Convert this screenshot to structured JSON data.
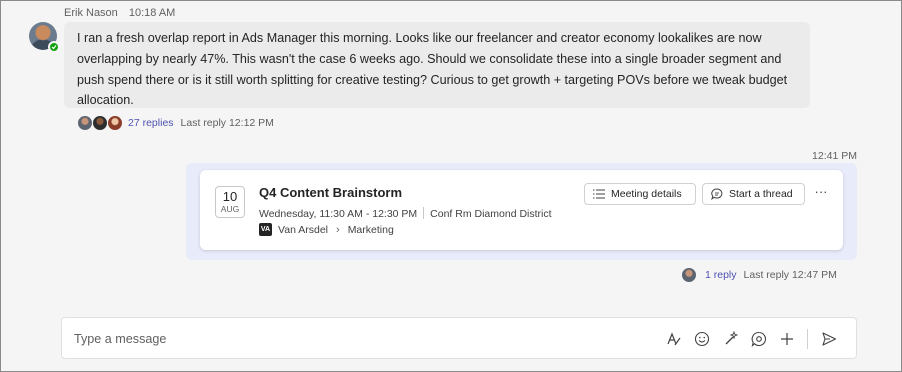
{
  "message1": {
    "sender": "Erik Nason",
    "time": "10:18 AM",
    "text": "I ran a fresh overlap report in Ads Manager this morning. Looks like our freelancer and creator economy lookalikes are now overlapping by nearly 47%. This wasn't the case 6 weeks ago. Should we consolidate these into a single broader segment and push spend there or is it still worth splitting for creative testing? Curious to get growth + targeting POVs before we tweak budget allocation.",
    "replies": "27 replies",
    "last_reply": "Last reply 12:12 PM"
  },
  "message2": {
    "time": "12:41 PM",
    "card": {
      "day": "10",
      "month": "AUG",
      "title": "Q4 Content Brainstorm",
      "when": "Wednesday, 11:30 AM - 12:30 PM",
      "location": "Conf Rm Diamond District",
      "org_logo": "VA",
      "org": "Van Arsdel",
      "channel": "Marketing",
      "details_label": "Meeting details",
      "thread_label": "Start a thread",
      "more_label": "···"
    },
    "replies": "1 reply",
    "last_reply": "Last reply 12:47 PM"
  },
  "compose": {
    "placeholder": "Type a message",
    "tools": [
      "format-icon",
      "emoji-icon",
      "copilot-icon",
      "loop-icon",
      "add-icon",
      "send-icon"
    ]
  },
  "colors": {
    "accent": "#4f52b2",
    "bubble": "#ebebeb",
    "outgoing": "#e8ebfa",
    "presence": "#13a10e"
  }
}
